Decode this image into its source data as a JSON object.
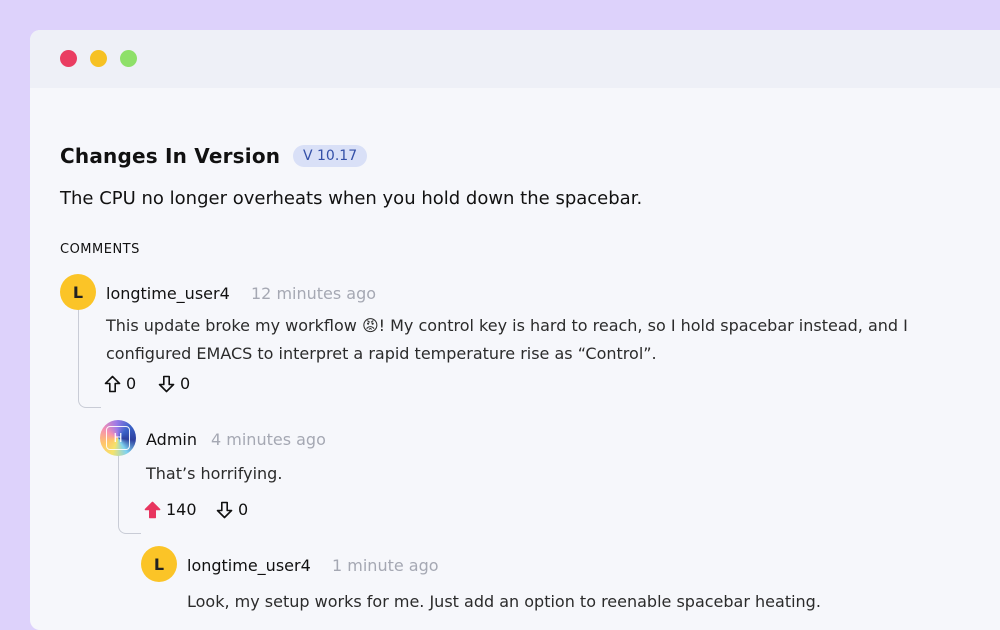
{
  "window": {
    "controls": [
      "close",
      "minimize",
      "maximize"
    ]
  },
  "header": {
    "title": "Changes In Version",
    "version": "V 10.17",
    "summary": "The CPU no longer overheats when you hold down the spacebar."
  },
  "comments_label": "COMMENTS",
  "comments": [
    {
      "avatar_letter": "L",
      "username": "longtime_user4",
      "time": "12 minutes ago",
      "line1": "This update broke my workflow 😡! My control key is hard to reach, so I hold spacebar instead, and I",
      "line2": "configured EMACS to interpret a rapid temperature rise as “Control”.",
      "upvotes": "0",
      "downvotes": "0"
    },
    {
      "avatar_letter": "H",
      "username": "Admin",
      "time": "4 minutes ago",
      "text": "That’s horrifying.",
      "upvotes": "140",
      "downvotes": "0",
      "upvoted": true,
      "upvote_color": "#e8355f"
    },
    {
      "avatar_letter": "L",
      "username": "longtime_user4",
      "time": "1 minute ago",
      "text": "Look, my setup works for me. Just add an option to reenable spacebar heating."
    }
  ]
}
